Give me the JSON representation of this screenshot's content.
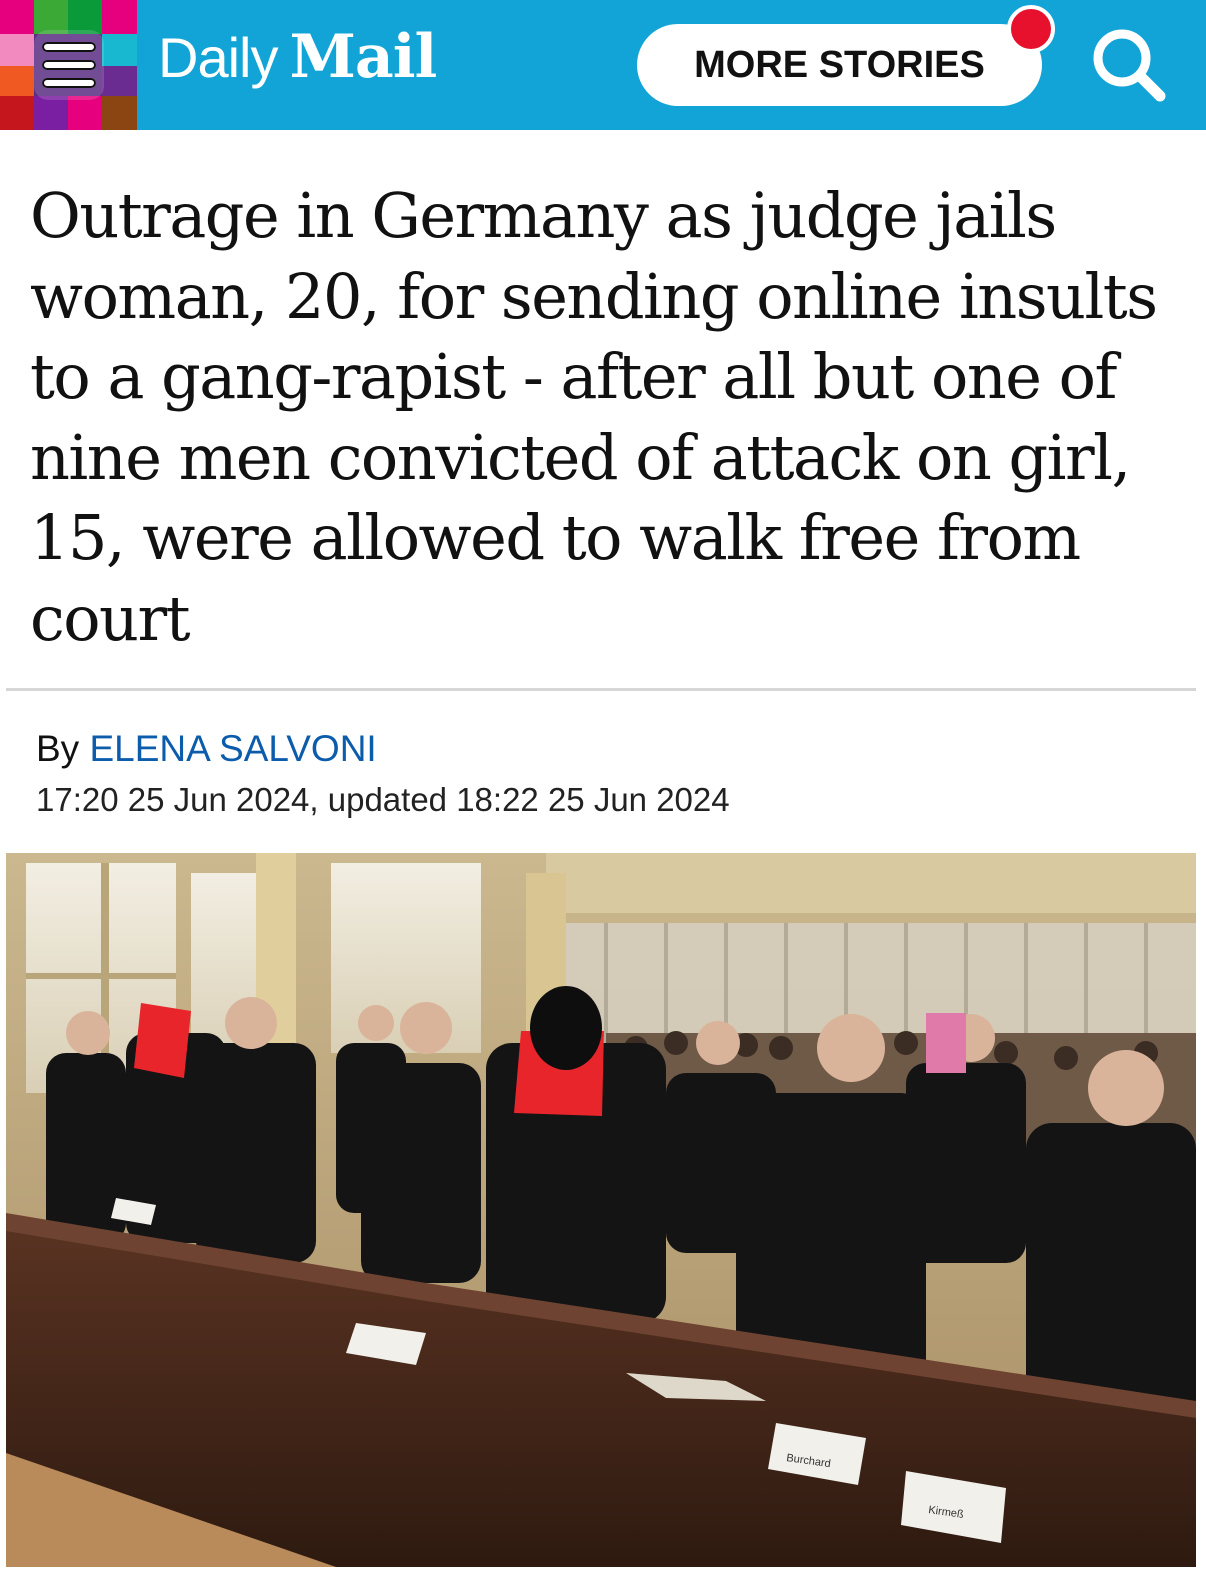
{
  "header": {
    "logo_daily": "Daily",
    "logo_mail": "Mail",
    "more_stories_label": "MORE STORIES",
    "menu_icon": "hamburger-menu-icon",
    "search_icon": "search-icon",
    "brand_color": "#12a4d6",
    "notification_color": "#e8112d"
  },
  "article": {
    "headline": "Outrage in Germany as judge jails woman, 20, for sending online insults to a gang-rapist - after all but one of nine men convicted of attack on girl, 15, were allowed to walk free from court",
    "by_label": "By",
    "author": "ELENA SALVONI",
    "dateline": "17:20 25 Jun 2024, updated 18:22 25 Jun 2024",
    "author_color": "#0c5cac"
  },
  "photo": {
    "nameplates": [
      "Burchard",
      "Kirmeß"
    ]
  }
}
